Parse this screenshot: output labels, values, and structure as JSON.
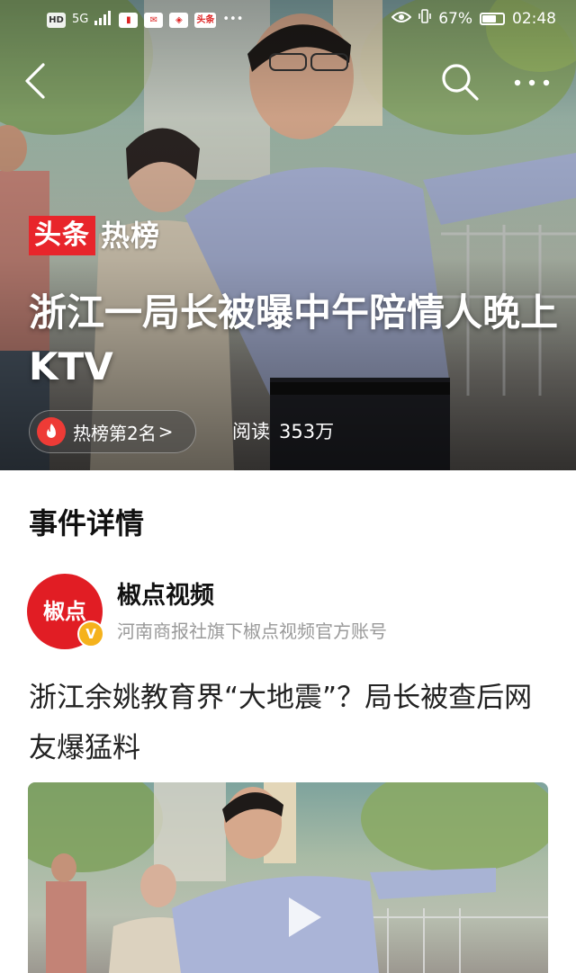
{
  "status_bar": {
    "left_chips": [
      "HD",
      "5G"
    ],
    "app_chip": "头条",
    "eye_icon": "eye-icon",
    "battery_percent": "67%",
    "battery_level": 0.67,
    "time": "02:48"
  },
  "hero": {
    "tag_part1": "头条",
    "tag_part2": "热榜",
    "title": "浙江一局长被曝中午陪情人晚上KTV",
    "rank_label": "热榜第2名",
    "rank_chevron": ">",
    "reads_label": "阅读",
    "reads_value": "353万"
  },
  "section": {
    "title": "事件详情"
  },
  "author": {
    "avatar_text": "椒点",
    "verified_badge": "V",
    "name": "椒点视频",
    "description": "河南商报社旗下椒点视频官方账号"
  },
  "article": {
    "title": "浙江余姚教育界“大地震”？局长被查后网友爆猛料"
  },
  "colors": {
    "brand_red": "#e8252b",
    "verified_gold": "#f5b21c",
    "muted_text": "#999999"
  },
  "icons": {
    "back": "back-arrow-icon",
    "search": "search-icon",
    "more": "more-dots-icon",
    "fire": "fire-icon",
    "play": "play-icon"
  }
}
